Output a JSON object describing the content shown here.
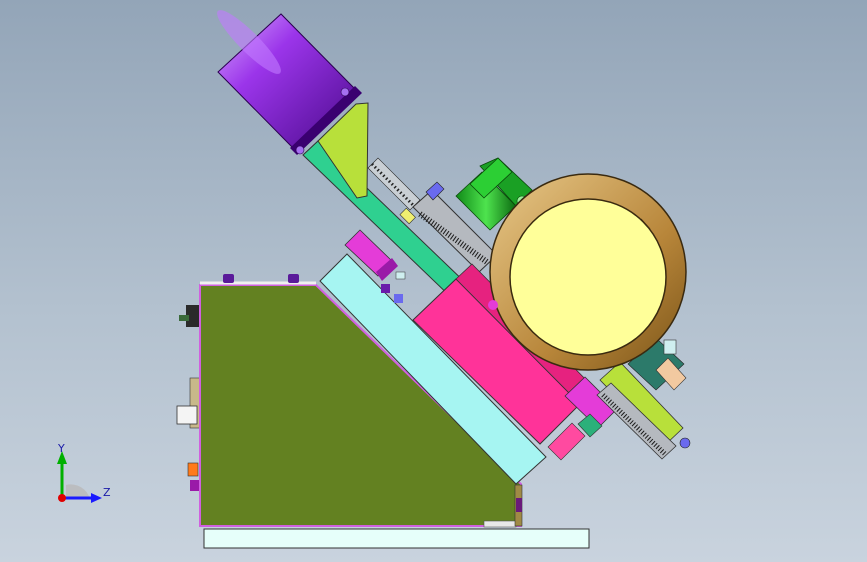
{
  "view": {
    "background_top": "#93a5b8",
    "background_bottom": "#c9d3de"
  },
  "triad": {
    "y_label": "Y",
    "z_label": "Z",
    "y_color": "#00b000",
    "z_color": "#1a1aff",
    "origin_color": "#e00000"
  },
  "parts": {
    "motor_color": "#8a2be2",
    "base_color": "#638121",
    "wedge_color": "#a6f5f2",
    "pink_slide_color": "#ff3399",
    "magenta_block_color": "#e43cd8",
    "rail_color": "#2fd090",
    "bracket_color": "#b8e03a",
    "green_cylinder_color": "#22c22c",
    "ring_color": "#c79a45",
    "disc_color": "#ffff99",
    "floor_plate_color": "#e6fffa"
  }
}
